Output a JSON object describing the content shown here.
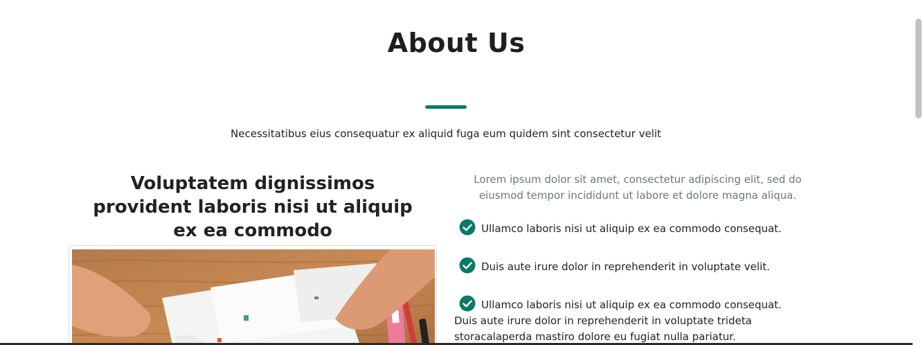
{
  "about": {
    "title": "About Us",
    "subtitle": "Necessitatibus eius consequatur ex aliquid fuga eum quidem sint consectetur velit",
    "accent_color": "#0b7a68"
  },
  "left": {
    "heading": "Voluptatem dignissimos provident laboris nisi ut aliquip ex ea commodo"
  },
  "right": {
    "intro": "Lorem ipsum dolor sit amet, consectetur adipiscing elit, sed do eiusmod tempor incididunt ut labore et dolore magna aliqua.",
    "features": [
      {
        "text": "Ullamco laboris nisi ut aliquip ex ea commodo consequat.",
        "icon": "check-circle-icon"
      },
      {
        "text": "Duis aute irure dolor in reprehenderit in voluptate velit.",
        "icon": "check-circle-icon"
      },
      {
        "text": "Ullamco laboris nisi ut aliquip ex ea commodo consequat. Duis aute irure dolor in reprehenderit in voluptate trideta storacalaperda mastiro dolore eu fugiat nulla pariatur.",
        "icon": "check-circle-icon"
      }
    ]
  }
}
